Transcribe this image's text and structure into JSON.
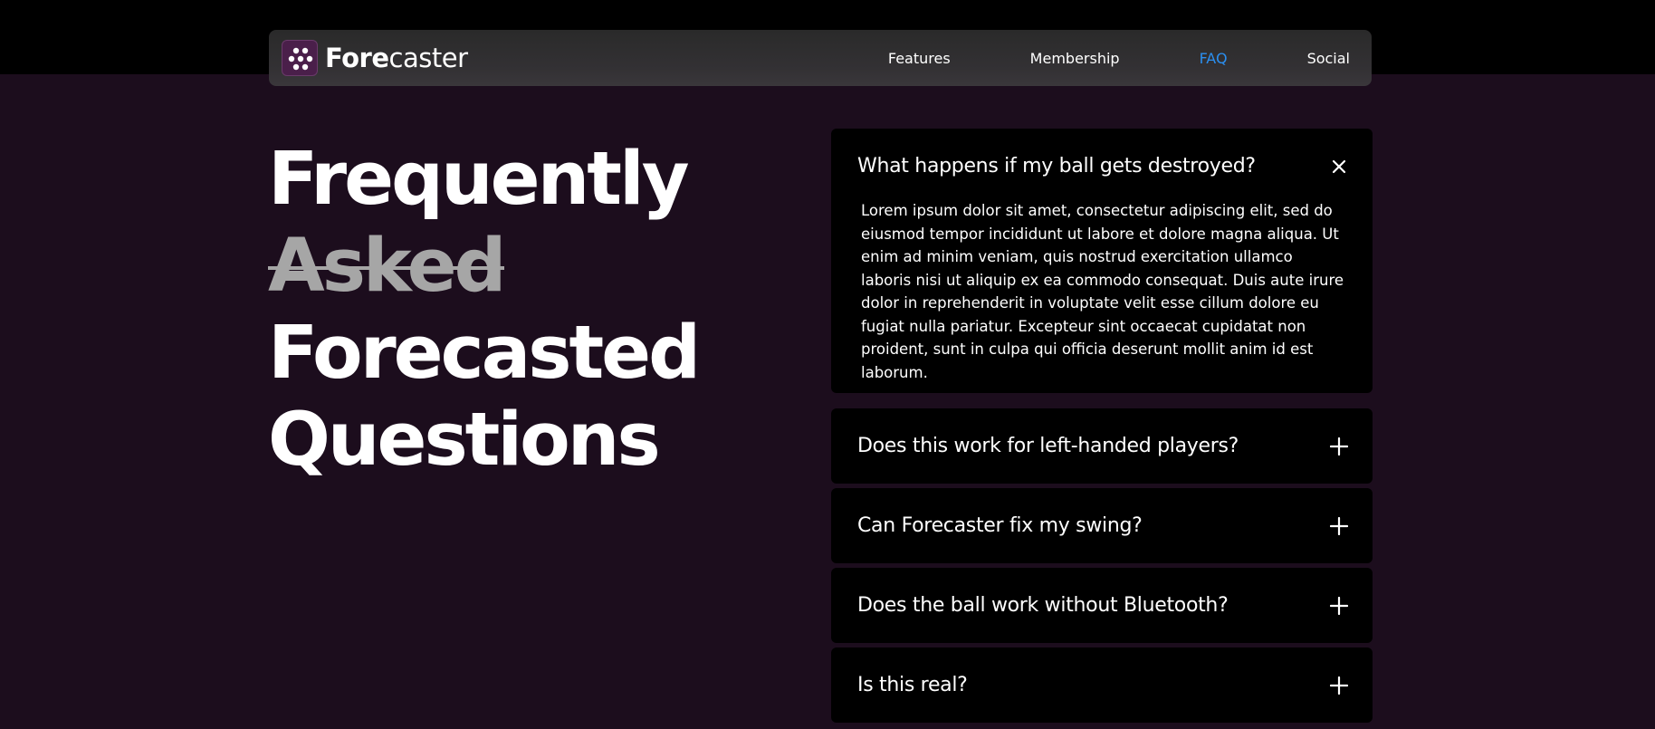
{
  "brand": {
    "name_bold": "Fore",
    "name_rest": "caster",
    "logo_icon": "golf-ball-dots-icon"
  },
  "nav": {
    "links": [
      {
        "label": "Features"
      },
      {
        "label": "Membership"
      },
      {
        "label": "FAQ",
        "active": true
      },
      {
        "label": "Social"
      }
    ]
  },
  "hero": {
    "line1": "Frequently",
    "line2": "Asked",
    "line3": "Forecasted",
    "line4": "Questions"
  },
  "faq": {
    "items": [
      {
        "question": "What happens if my ball gets destroyed?",
        "answer": "Lorem ipsum dolor sit amet, consectetur adipiscing elit, sed do eiusmod tempor incididunt ut labore et dolore magna aliqua. Ut enim ad minim veniam, quis nostrud exercitation ullamco laboris nisi ut aliquip ex ea commodo consequat. Duis aute irure dolor in reprehenderit in voluptate velit esse cillum dolore eu fugiat nulla pariatur. Excepteur sint occaecat cupidatat non proident, sunt in culpa qui officia deserunt mollit anim id est laborum.",
        "expanded": true,
        "toggle_icon": "close-icon"
      },
      {
        "question": "Does this work for left-handed players?",
        "expanded": false,
        "toggle_icon": "plus-icon"
      },
      {
        "question": "Can Forecaster fix my swing?",
        "expanded": false,
        "toggle_icon": "plus-icon"
      },
      {
        "question": "Does the ball work without Bluetooth?",
        "expanded": false,
        "toggle_icon": "plus-icon"
      },
      {
        "question": "Is this real?",
        "expanded": false,
        "toggle_icon": "plus-icon"
      }
    ]
  },
  "colors": {
    "background": "#1c0d1d",
    "top_band": "#000000",
    "accent_link": "#2b8ff0",
    "card": "#000000",
    "struck_text": "#a6a6a6"
  }
}
